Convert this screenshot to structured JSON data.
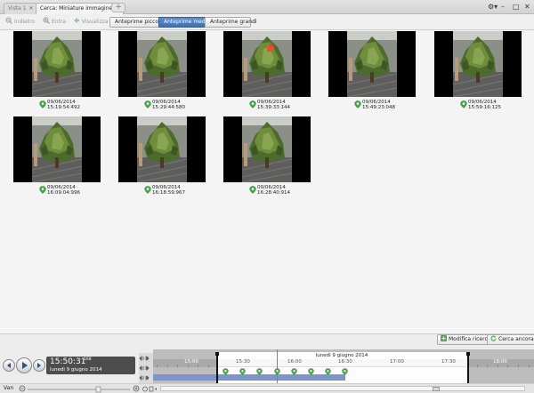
{
  "tabs": [
    {
      "label": "Vista 1",
      "close": "×",
      "active": false
    },
    {
      "label": "Cerca: Miniature immagine",
      "close": "×",
      "active": true
    }
  ],
  "tab_add_label": "+",
  "window_controls": {
    "settings": "⚙▾",
    "minimize": "–",
    "maximize": "□",
    "close": "✕"
  },
  "toolbar": {
    "back_label": "Indietro",
    "enter_label": "Entra",
    "view_label": "Visualizza",
    "size_options": [
      "Anteprime piccole",
      "Anteprime medie",
      "Anteprime grandi"
    ],
    "selected_size": "Anteprime medie"
  },
  "thumbnails": [
    {
      "date": "09/06/2014",
      "time": "15:19:54:492"
    },
    {
      "date": "09/06/2014",
      "time": "15:29:44:580"
    },
    {
      "date": "09/06/2014",
      "time": "15:39:33:144"
    },
    {
      "date": "09/06/2014",
      "time": "15:49:23:048"
    },
    {
      "date": "09/06/2014",
      "time": "15:59:16:125"
    },
    {
      "date": "09/06/2014",
      "time": "16:09:04:996"
    },
    {
      "date": "09/06/2014",
      "time": "16:18:59:967"
    },
    {
      "date": "09/06/2014",
      "time": "16:28:40:914"
    }
  ],
  "actions": {
    "modify_search": "Modifica ricerca",
    "search_again": "Cerca ancora"
  },
  "player": {
    "time": "15:50:31",
    "millis": "168",
    "date": "lunedì 9 giugno 2014"
  },
  "timeline": {
    "date_label": "lunedì 9 giugno 2014",
    "ticks": [
      "15:00",
      "15:30",
      "16:00",
      "16:30",
      "17:00",
      "17:30",
      "18:00"
    ]
  },
  "status": {
    "label": "Van"
  },
  "colors": {
    "accent": "#3c6fb5",
    "pin_green": "#3faa3f",
    "track": "#7b96cf",
    "cursor": "#e55555"
  }
}
